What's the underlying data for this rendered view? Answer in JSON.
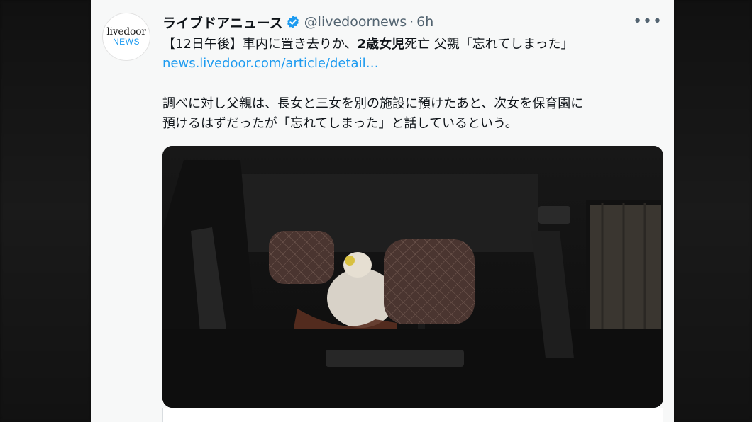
{
  "account": {
    "display_name": "ライブドアニュース",
    "handle": "@livedoornews",
    "separator": "·",
    "time": "6h",
    "avatar_line1": "livedoor",
    "avatar_line2": "NEWS",
    "verified_icon": "verified-badge-icon"
  },
  "tweet": {
    "headline_prefix": "【12日午後】車内に置き去りか、",
    "headline_bold": "2歳女児",
    "headline_suffix": "死亡 父親「忘れてしまった」",
    "link_text": "news.livedoor.com/article/detail…",
    "body_line1": "調べに対し父親は、長女と三女を別の施設に預けたあと、次女を保育園に",
    "body_line2": "預けるはずだったが「忘れてしまった」と話しているという。"
  },
  "menu": {
    "more_label": "•••"
  },
  "colors": {
    "link": "#1d9bf0",
    "text": "#0f1419",
    "muted": "#536471",
    "background": "#f7f8f8"
  }
}
